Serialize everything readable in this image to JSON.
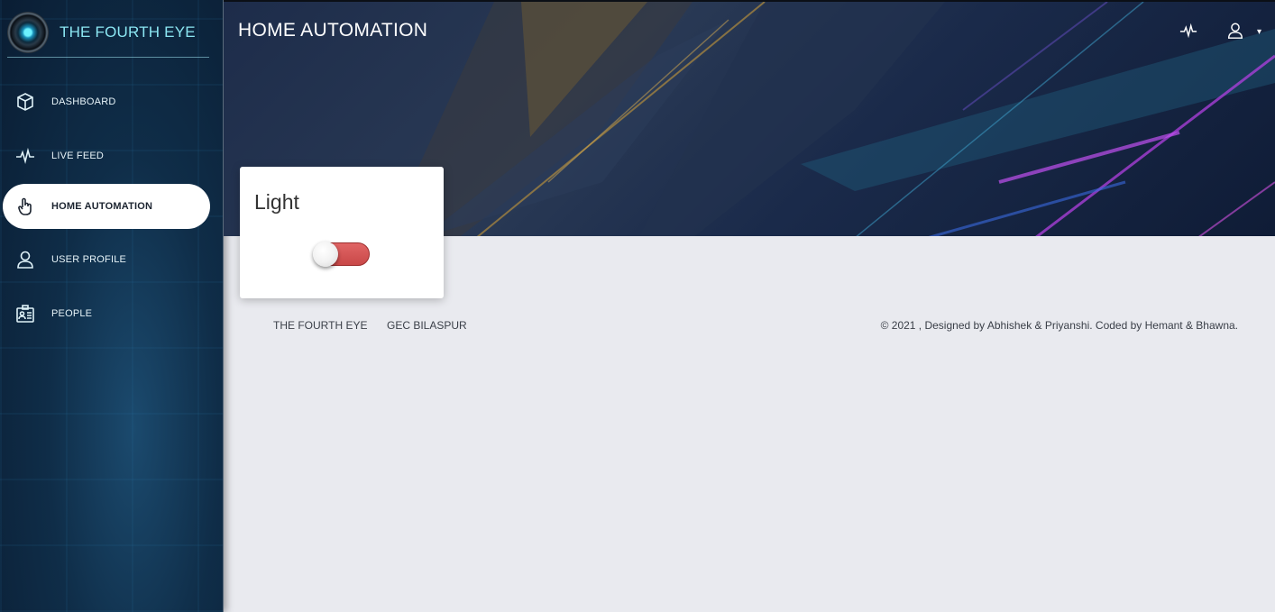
{
  "sidebar": {
    "brand": "THE FOURTH EYE",
    "items": [
      {
        "label": "DASHBOARD",
        "icon": "cube-icon"
      },
      {
        "label": "LIVE FEED",
        "icon": "pulse-icon"
      },
      {
        "label": "HOME AUTOMATION",
        "icon": "touch-icon",
        "active": true
      },
      {
        "label": "USER PROFILE",
        "icon": "user-icon"
      },
      {
        "label": "PEOPLE",
        "icon": "id-card-icon"
      }
    ]
  },
  "header": {
    "title": "HOME AUTOMATION",
    "icons": [
      "pulse-icon",
      "user-icon"
    ]
  },
  "card": {
    "title": "Light",
    "toggle_state": "off"
  },
  "footer": {
    "links": [
      "THE FOURTH EYE",
      "GEC BILASPUR"
    ],
    "copyright": "© 2021 , Designed by Abhishek & Priyanshi. Coded by Hemant & Bhawna."
  },
  "colors": {
    "sidebar_bg": "#0f2d48",
    "accent": "#8be6f2",
    "toggle_off": "#d35555",
    "page_bg": "#e9eaef"
  }
}
